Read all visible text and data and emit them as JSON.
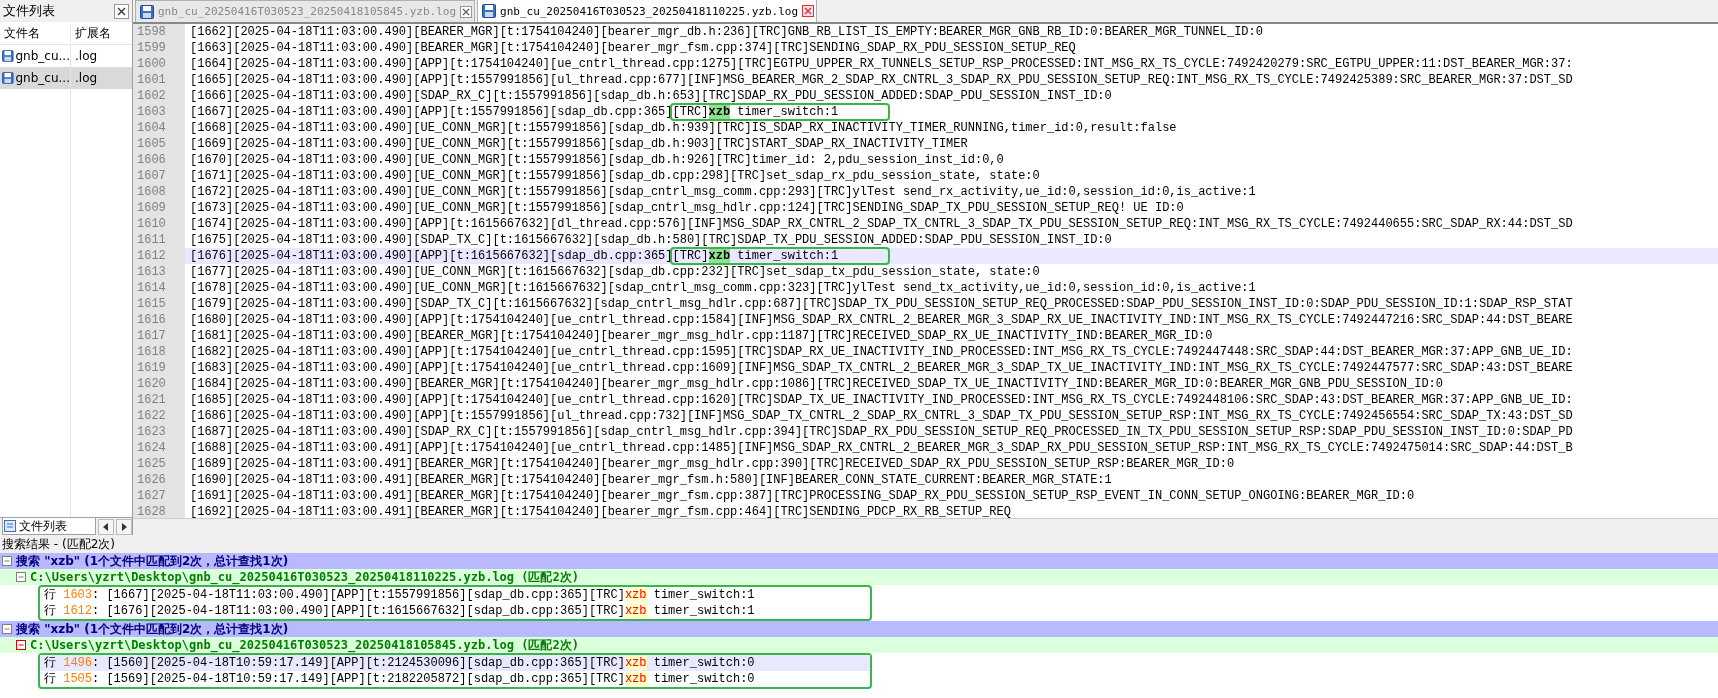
{
  "file_panel": {
    "title": "文件列表",
    "columns": [
      "文件名",
      "扩展名"
    ],
    "files": [
      {
        "name": "gnb_cu...",
        "ext": ".log",
        "selected": false
      },
      {
        "name": "gnb_cu...",
        "ext": ".log",
        "selected": true
      }
    ],
    "bottom_tab": "文件列表"
  },
  "tabs": [
    {
      "label": "gnb_cu_20250416T030523_20250418105845.yzb.log",
      "selected": false
    },
    {
      "label": "gnb_cu_20250416T030523_20250418110225.yzb.log",
      "selected": true
    }
  ],
  "editor": {
    "lines": [
      {
        "num": "1598",
        "text": "[1662][2025-04-18T11:03:00.490][BEARER_MGR][t:1754104240][bearer_mgr_db.h:236][TRC]GNB_RB_LIST_IS_EMPTY:BEARER_MGR_GNB_RB_ID:0:BEARER_MGR_TUNNEL_ID:0",
        "selected": false
      },
      {
        "num": "1599",
        "text": "[1663][2025-04-18T11:03:00.490][BEARER_MGR][t:1754104240][bearer_mgr_fsm.cpp:374][TRC]SENDING_SDAP_RX_PDU_SESSION_SETUP_REQ",
        "selected": false
      },
      {
        "num": "1600",
        "text": "[1664][2025-04-18T11:03:00.490][APP][t:1754104240][ue_cntrl_thread.cpp:1275][TRC]EGTPU_UPPER_RX_TUNNELS_SETUP_RSP_PROCESSED:INT_MSG_RX_TS_CYCLE:7492420279:SRC_EGTPU_UPPER:11:DST_BEARER_MGR:37:",
        "selected": false
      },
      {
        "num": "1601",
        "text": "[1665][2025-04-18T11:03:00.490][APP][t:1557991856][ul_thread.cpp:677][INF]MSG_BEARER_MGR_2_SDAP_RX_CNTRL_3_SDAP_RX_PDU_SESSION_SETUP_REQ:INT_MSG_RX_TS_CYCLE:7492425389:SRC_BEARER_MGR:37:DST_SD",
        "selected": false
      },
      {
        "num": "1602",
        "text": "[1666][2025-04-18T11:03:00.490][SDAP_RX_C][t:1557991856][sdap_db.h:653][TRC]SDAP_RX_PDU_SESSION_ADDED:SDAP_PDU_SESSION_INST_ID:0",
        "selected": false
      },
      {
        "num": "1603",
        "text": "[1667][2025-04-18T11:03:00.490][APP][t:1557991856][sdap_db.cpp:365]",
        "hit": {
          "before": "[TRC]",
          "word": "xzb",
          "after": " timer_switch:1"
        },
        "selected": false
      },
      {
        "num": "1604",
        "text": "[1668][2025-04-18T11:03:00.490][UE_CONN_MGR][t:1557991856][sdap_db.h:939][TRC]IS_SDAP_RX_INACTIVITY_TIMER_RUNNING,timer_id:0,result:false",
        "selected": false
      },
      {
        "num": "1605",
        "text": "[1669][2025-04-18T11:03:00.490][UE_CONN_MGR][t:1557991856][sdap_db.h:903][TRC]START_SDAP_RX_INACTIVITY_TIMER",
        "selected": false
      },
      {
        "num": "1606",
        "text": "[1670][2025-04-18T11:03:00.490][UE_CONN_MGR][t:1557991856][sdap_db.h:926][TRC]timer_id: 2,pdu_session_inst_id:0,0",
        "selected": false
      },
      {
        "num": "1607",
        "text": "[1671][2025-04-18T11:03:00.490][UE_CONN_MGR][t:1557991856][sdap_db.cpp:298][TRC]set_sdap_rx_pdu_session_state, state:0",
        "selected": false
      },
      {
        "num": "1608",
        "text": "[1672][2025-04-18T11:03:00.490][UE_CONN_MGR][t:1557991856][sdap_cntrl_msg_comm.cpp:293][TRC]ylTest send_rx_activity,ue_id:0,session_id:0,is_active:1",
        "selected": false
      },
      {
        "num": "1609",
        "text": "[1673][2025-04-18T11:03:00.490][UE_CONN_MGR][t:1557991856][sdap_cntrl_msg_hdlr.cpp:124][TRC]SENDING_SDAP_TX_PDU_SESSION_SETUP_REQ! UE ID:0",
        "selected": false
      },
      {
        "num": "1610",
        "text": "[1674][2025-04-18T11:03:00.490][APP][t:1615667632][dl_thread.cpp:576][INF]MSG_SDAP_RX_CNTRL_2_SDAP_TX_CNTRL_3_SDAP_TX_PDU_SESSION_SETUP_REQ:INT_MSG_RX_TS_CYCLE:7492440655:SRC_SDAP_RX:44:DST_SD",
        "selected": false
      },
      {
        "num": "1611",
        "text": "[1675][2025-04-18T11:03:00.490][SDAP_TX_C][t:1615667632][sdap_db.h:580][TRC]SDAP_TX_PDU_SESSION_ADDED:SDAP_PDU_SESSION_INST_ID:0",
        "selected": false
      },
      {
        "num": "1612",
        "text": "[1676][2025-04-18T11:03:00.490][APP][t:1615667632][sdap_db.cpp:365]",
        "hit": {
          "before": "[TRC]",
          "word": "xzb",
          "after": " timer_switch:1"
        },
        "selected": true
      },
      {
        "num": "1613",
        "text": "[1677][2025-04-18T11:03:00.490][UE_CONN_MGR][t:1615667632][sdap_db.cpp:232][TRC]set_sdap_tx_pdu_session_state, state:0",
        "selected": false
      },
      {
        "num": "1614",
        "text": "[1678][2025-04-18T11:03:00.490][UE_CONN_MGR][t:1615667632][sdap_cntrl_msg_comm.cpp:323][TRC]ylTest send_tx_activity,ue_id:0,session_id:0,is_active:1",
        "selected": false
      },
      {
        "num": "1615",
        "text": "[1679][2025-04-18T11:03:00.490][SDAP_TX_C][t:1615667632][sdap_cntrl_msg_hdlr.cpp:687][TRC]SDAP_TX_PDU_SESSION_SETUP_REQ_PROCESSED:SDAP_PDU_SESSION_INST_ID:0:SDAP_PDU_SESSION_ID:1:SDAP_RSP_STAT",
        "selected": false
      },
      {
        "num": "1616",
        "text": "[1680][2025-04-18T11:03:00.490][APP][t:1754104240][ue_cntrl_thread.cpp:1584][INF]MSG_SDAP_RX_CNTRL_2_BEARER_MGR_3_SDAP_RX_UE_INACTIVITY_IND:INT_MSG_RX_TS_CYCLE:7492447216:SRC_SDAP:44:DST_BEARE",
        "selected": false
      },
      {
        "num": "1617",
        "text": "[1681][2025-04-18T11:03:00.490][BEARER_MGR][t:1754104240][bearer_mgr_msg_hdlr.cpp:1187][TRC]RECEIVED_SDAP_RX_UE_INACTIVITY_IND:BEARER_MGR_ID:0",
        "selected": false
      },
      {
        "num": "1618",
        "text": "[1682][2025-04-18T11:03:00.490][APP][t:1754104240][ue_cntrl_thread.cpp:1595][TRC]SDAP_RX_UE_INACTIVITY_IND_PROCESSED:INT_MSG_RX_TS_CYCLE:7492447448:SRC_SDAP:44:DST_BEARER_MGR:37:APP_GNB_UE_ID:",
        "selected": false
      },
      {
        "num": "1619",
        "text": "[1683][2025-04-18T11:03:00.490][APP][t:1754104240][ue_cntrl_thread.cpp:1609][INF]MSG_SDAP_TX_CNTRL_2_BEARER_MGR_3_SDAP_TX_UE_INACTIVITY_IND:INT_MSG_RX_TS_CYCLE:7492447577:SRC_SDAP:43:DST_BEARE",
        "selected": false
      },
      {
        "num": "1620",
        "text": "[1684][2025-04-18T11:03:00.490][BEARER_MGR][t:1754104240][bearer_mgr_msg_hdlr.cpp:1086][TRC]RECEIVED_SDAP_TX_UE_INACTIVITY_IND:BEARER_MGR_ID:0:BEARER_MGR_GNB_PDU_SESSION_ID:0",
        "selected": false
      },
      {
        "num": "1621",
        "text": "[1685][2025-04-18T11:03:00.490][APP][t:1754104240][ue_cntrl_thread.cpp:1620][TRC]SDAP_TX_UE_INACTIVITY_IND_PROCESSED:INT_MSG_RX_TS_CYCLE:7492448106:SRC_SDAP:43:DST_BEARER_MGR:37:APP_GNB_UE_ID:",
        "selected": false
      },
      {
        "num": "1622",
        "text": "[1686][2025-04-18T11:03:00.490][APP][t:1557991856][ul_thread.cpp:732][INF]MSG_SDAP_TX_CNTRL_2_SDAP_RX_CNTRL_3_SDAP_TX_PDU_SESSION_SETUP_RSP:INT_MSG_RX_TS_CYCLE:7492456554:SRC_SDAP_TX:43:DST_SD",
        "selected": false
      },
      {
        "num": "1623",
        "text": "[1687][2025-04-18T11:03:00.490][SDAP_RX_C][t:1557991856][sdap_cntrl_msg_hdlr.cpp:394][TRC]SDAP_RX_PDU_SESSION_SETUP_REQ_PROCESSED_IN_TX_PDU_SESSION_SETUP_RSP:SDAP_PDU_SESSION_INST_ID:0:SDAP_PD",
        "selected": false
      },
      {
        "num": "1624",
        "text": "[1688][2025-04-18T11:03:00.491][APP][t:1754104240][ue_cntrl_thread.cpp:1485][INF]MSG_SDAP_RX_CNTRL_2_BEARER_MGR_3_SDAP_RX_PDU_SESSION_SETUP_RSP:INT_MSG_RX_TS_CYCLE:7492475014:SRC_SDAP:44:DST_B",
        "selected": false
      },
      {
        "num": "1625",
        "text": "[1689][2025-04-18T11:03:00.491][BEARER_MGR][t:1754104240][bearer_mgr_msg_hdlr.cpp:390][TRC]RECEIVED_SDAP_RX_PDU_SESSION_SETUP_RSP:BEARER_MGR_ID:0",
        "selected": false
      },
      {
        "num": "1626",
        "text": "[1690][2025-04-18T11:03:00.491][BEARER_MGR][t:1754104240][bearer_mgr_fsm.h:580][INF]BEARER_CONN_STATE_CURRENT:BEARER_MGR_STATE:1",
        "selected": false
      },
      {
        "num": "1627",
        "text": "[1691][2025-04-18T11:03:00.491][BEARER_MGR][t:1754104240][bearer_mgr_fsm.cpp:387][TRC]PROCESSING_SDAP_RX_PDU_SESSION_SETUP_RSP_EVENT_IN_CONN_SETUP_ONGOING:BEARER_MGR_ID:0",
        "selected": false
      },
      {
        "num": "1628",
        "text": "[1692][2025-04-18T11:03:00.491][BEARER_MGR][t:1754104240][bearer_mgr_fsm.cpp:464][TRC]SENDING_PDCP_RX_RB_SETUP_REQ",
        "selected": false
      }
    ]
  },
  "search_results": {
    "title": "搜索结果 - (匹配2次)",
    "groups": [
      {
        "header": "搜索 \"xzb\" (1个文件中匹配到2次，总计查找1次)",
        "file": "C:\\Users\\yzrt\\Desktop\\gnb_cu_20250416T030523_20250418110225.yzb.log (匹配2次)",
        "selected": false,
        "hits": [
          {
            "label": "行",
            "line": "1603",
            "before": ": [1667][2025-04-18T11:03:00.490][APP][t:1557991856][sdap_db.cpp:365][TRC]",
            "word": "xzb",
            "after": " timer_switch:1",
            "selected": false
          },
          {
            "label": "行",
            "line": "1612",
            "before": ": [1676][2025-04-18T11:03:00.490][APP][t:1615667632][sdap_db.cpp:365][TRC]",
            "word": "xzb",
            "after": " timer_switch:1",
            "selected": false
          }
        ]
      },
      {
        "header": "搜索 \"xzb\" (1个文件中匹配到2次，总计查找1次)",
        "file": "C:\\Users\\yzrt\\Desktop\\gnb_cu_20250416T030523_20250418105845.yzb.log (匹配2次)",
        "selected": true,
        "hits": [
          {
            "label": "行",
            "line": "1496",
            "before": ": [1560][2025-04-18T10:59:17.149][APP][t:2124530096][sdap_db.cpp:365][TRC]",
            "word": "xzb",
            "after": " timer_switch:0",
            "selected": true
          },
          {
            "label": "行",
            "line": "1505",
            "before": ": [1569][2025-04-18T10:59:17.149][APP][t:2182205872][sdap_db.cpp:365][TRC]",
            "word": "xzb",
            "after": " timer_switch:0",
            "selected": false
          }
        ]
      }
    ]
  }
}
